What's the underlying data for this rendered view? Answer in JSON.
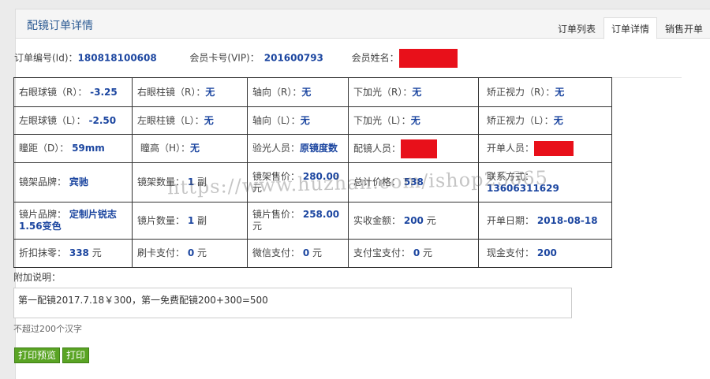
{
  "header": {
    "title": "配镜订单详情",
    "tabs": [
      {
        "label": "订单列表"
      },
      {
        "label": "订单详情",
        "active": true
      },
      {
        "label": "销售开单"
      }
    ]
  },
  "order": {
    "order_no_label": "订单编号(Id)：",
    "order_no": "180818100608",
    "card_label": "会员卡号(VIP)：",
    "card_no": "201600793",
    "name_label": "会员姓名："
  },
  "grid": {
    "r1": [
      {
        "label": "右眼球镜（R）：",
        "value": "-3.25"
      },
      {
        "label": "右眼柱镜（R）：",
        "value": "无"
      },
      {
        "label": "轴向（R）：",
        "value": "无"
      },
      {
        "label": "下加光（R）：",
        "value": "无"
      },
      {
        "label": "矫正视力（R）：",
        "value": "无"
      }
    ],
    "r2": [
      {
        "label": "左眼球镜（L）：",
        "value": "-2.50"
      },
      {
        "label": "左眼柱镜（L）：",
        "value": "无"
      },
      {
        "label": "轴向（L）：",
        "value": "无"
      },
      {
        "label": "下加光（L）：",
        "value": "无"
      },
      {
        "label": "矫正视力（L）：",
        "value": "无"
      }
    ],
    "r3": [
      {
        "label": "瞳距（D）：",
        "value": "59mm"
      },
      {
        "label": "瞳高（H）：",
        "value": "无"
      },
      {
        "label": "验光人员：",
        "value": "原镜度数"
      },
      {
        "label": "配镜人员：",
        "value": ""
      },
      {
        "label": "开单人员：",
        "value": ""
      }
    ],
    "r4": [
      {
        "label": "镜架品牌：",
        "value": "宾驰"
      },
      {
        "label": "镜架数量：",
        "value": "1",
        "unit": "副"
      },
      {
        "label": "镜架售价：",
        "value": "280.00",
        "unit": "元"
      },
      {
        "label": "总计价格：",
        "value": "538"
      },
      {
        "label": "联系方式：",
        "value": "13606311629"
      }
    ],
    "r5": [
      {
        "label": "镜片品牌：",
        "value": "定制片锐志1.56变色"
      },
      {
        "label": "镜片数量：",
        "value": "1",
        "unit": "副"
      },
      {
        "label": "镜片售价：",
        "value": "258.00",
        "unit": "元"
      },
      {
        "label": "实收金额：",
        "value": "200",
        "unit": "元"
      },
      {
        "label": "开单日期：",
        "value": "2018-08-18"
      }
    ],
    "r6": [
      {
        "label": "折扣抹零：",
        "value": "338",
        "unit": "元"
      },
      {
        "label": "刷卡支付：",
        "value": "0",
        "unit": "元"
      },
      {
        "label": "微信支付：",
        "value": "0",
        "unit": "元"
      },
      {
        "label": "支付宝支付：",
        "value": "0",
        "unit": "元"
      },
      {
        "label": "现金支付：",
        "value": "200"
      }
    ]
  },
  "note": {
    "label": "附加说明：",
    "value": "第一配镜2017.7.18￥300，第一免费配镜200+300=500",
    "hint": "不超过200个汉字"
  },
  "buttons": {
    "preview": "打印预览",
    "print": "打印"
  },
  "watermark": "https://www.huzhan.com/ishop25665",
  "colors": {
    "value_blue": "#1c46a0",
    "title_blue": "#2f5d95",
    "redaction_red": "#e8101a",
    "button_green": "#5aa424"
  }
}
